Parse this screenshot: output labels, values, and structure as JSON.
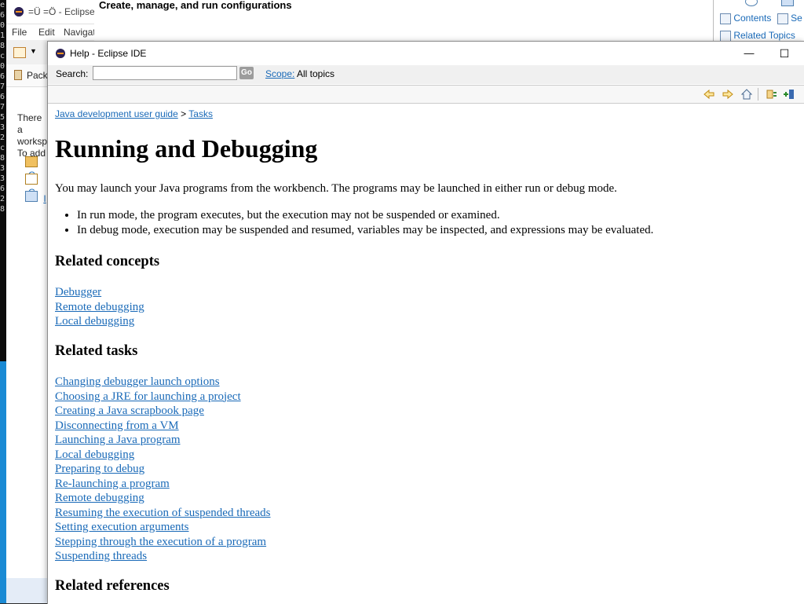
{
  "background": {
    "terminal_glyphs": [
      "e",
      "6",
      "0",
      "",
      "1",
      "8",
      "c",
      "0",
      "6",
      "7",
      "6",
      "7",
      "5",
      "3",
      "2",
      "c",
      "8",
      "3",
      "3",
      "6",
      "2",
      "8"
    ],
    "eclipse": {
      "title": "=Ü =Ö - Eclipse",
      "menu": [
        "File",
        "Edit",
        "Navigat"
      ],
      "package_tab": "Pack",
      "package_text": [
        "There a",
        "worksp",
        "To add"
      ],
      "package_links": [
        "C",
        "C",
        "I"
      ]
    },
    "banner": {
      "text": "Create, manage, and run configurations"
    },
    "right_panel": {
      "items": [
        "Contents",
        "Se",
        "Related Topics"
      ]
    }
  },
  "help": {
    "title": "Help - Eclipse IDE",
    "minimize_glyph": "—",
    "maximize_glyph": "☐",
    "search": {
      "label": "Search:",
      "value": "",
      "go": "Go",
      "scope_link": "Scope:",
      "scope_value": "All topics"
    },
    "nav_icons": [
      "back-icon",
      "forward-icon",
      "home-icon",
      "sync-toc-icon",
      "bookmark-icon"
    ],
    "breadcrumb": [
      "Java development user guide",
      "Tasks"
    ],
    "breadcrumb_sep": ">",
    "heading": "Running and Debugging",
    "intro": "You may launch your Java programs from the workbench.  The programs may be launched in either run or debug mode.",
    "bullets": [
      "In run mode, the program executes, but the execution may not be suspended or examined.",
      "In debug mode, execution may be suspended and resumed, variables may be inspected, and expressions may be evaluated."
    ],
    "related_concepts": {
      "title": "Related concepts",
      "links": [
        "Debugger",
        "Remote debugging",
        "Local debugging"
      ]
    },
    "related_tasks": {
      "title": "Related tasks",
      "links": [
        "Changing debugger launch options",
        "Choosing a JRE for launching a project",
        "Creating a Java scrapbook page",
        "Disconnecting from a VM",
        "Launching a Java program",
        "Local debugging",
        "Preparing to debug",
        "Re-launching a program",
        "Remote debugging",
        "Resuming the execution of suspended threads",
        "Setting execution arguments",
        "Stepping through the execution of a program",
        "Suspending threads"
      ]
    },
    "related_references": {
      "title": "Related references"
    }
  }
}
